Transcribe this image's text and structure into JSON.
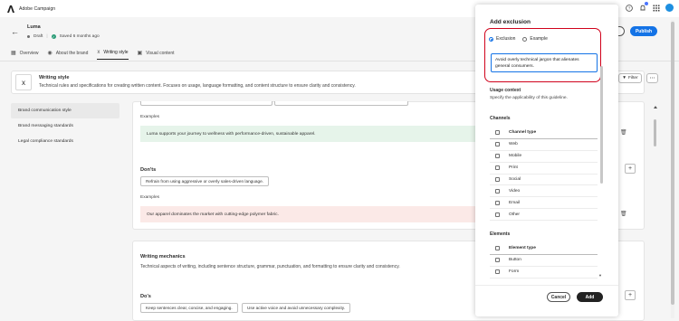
{
  "app": {
    "title": "Adobe Campaign"
  },
  "colors": {
    "accent": "#1473e6",
    "highlight": "#d0021b",
    "good_bg": "#e6f4ea",
    "bad_bg": "#fbe9e7"
  },
  "header": {
    "brand_name": "Luma",
    "status_draft": "Draft",
    "status_saved": "Saved 6 months ago",
    "publish_label": "Publish"
  },
  "tabs": [
    {
      "label": "Overview",
      "icon": "overview-icon"
    },
    {
      "label": "About the brand",
      "icon": "brand-icon"
    },
    {
      "label": "Writing style",
      "icon": "writing-icon",
      "active": true
    },
    {
      "label": "Visual content",
      "icon": "image-icon"
    }
  ],
  "section": {
    "title": "Writing style",
    "description": "Technical rules and specifications for creating written content. Focuses on usage, language formatting, and content structure to ensure clarity and consistency.",
    "filter_label": "Filter"
  },
  "left_nav": [
    {
      "label": "Brand communication style",
      "active": true
    },
    {
      "label": "Brand messaging standards"
    },
    {
      "label": "Legal compliance standards"
    }
  ],
  "communication": {
    "examples_label": "Examples",
    "good_example": "Luma supports your journey to wellness with performance-driven, sustainable apparel.",
    "donts_title": "Don'ts",
    "dont_pill": "Refrain from using aggressive or overly sales-driven language.",
    "examples_label_2": "Examples",
    "bad_example": "Our apparel dominates the market with cutting-edge polymer fabric."
  },
  "mechanics": {
    "title": "Writing mechanics",
    "description": "Technical aspects of writing, including sentence structure, grammar, punctuation, and formatting to ensure clarity and consistency.",
    "dos_title": "Do's",
    "do_pills": [
      "Keep sentences clear, concise, and engaging.",
      "Use active voice and avoid unnecessary complexity."
    ]
  },
  "dialog": {
    "title": "Add exclusion",
    "radio_exclusion": "Exclusion",
    "radio_example": "Example",
    "textarea_value": "Avoid overly technical jargon that alienates general consumers.",
    "usage_title": "Usage context",
    "usage_desc": "Specify the applicability of this guideline.",
    "channels_title": "Channels",
    "channel_header": "Channel type",
    "channels": [
      "Web",
      "Mobile",
      "Print",
      "Social",
      "Video",
      "Email",
      "Other"
    ],
    "elements_title": "Elements",
    "element_header": "Element type",
    "elements": [
      "Button",
      "Form"
    ],
    "cancel_label": "Cancel",
    "add_label": "Add"
  }
}
